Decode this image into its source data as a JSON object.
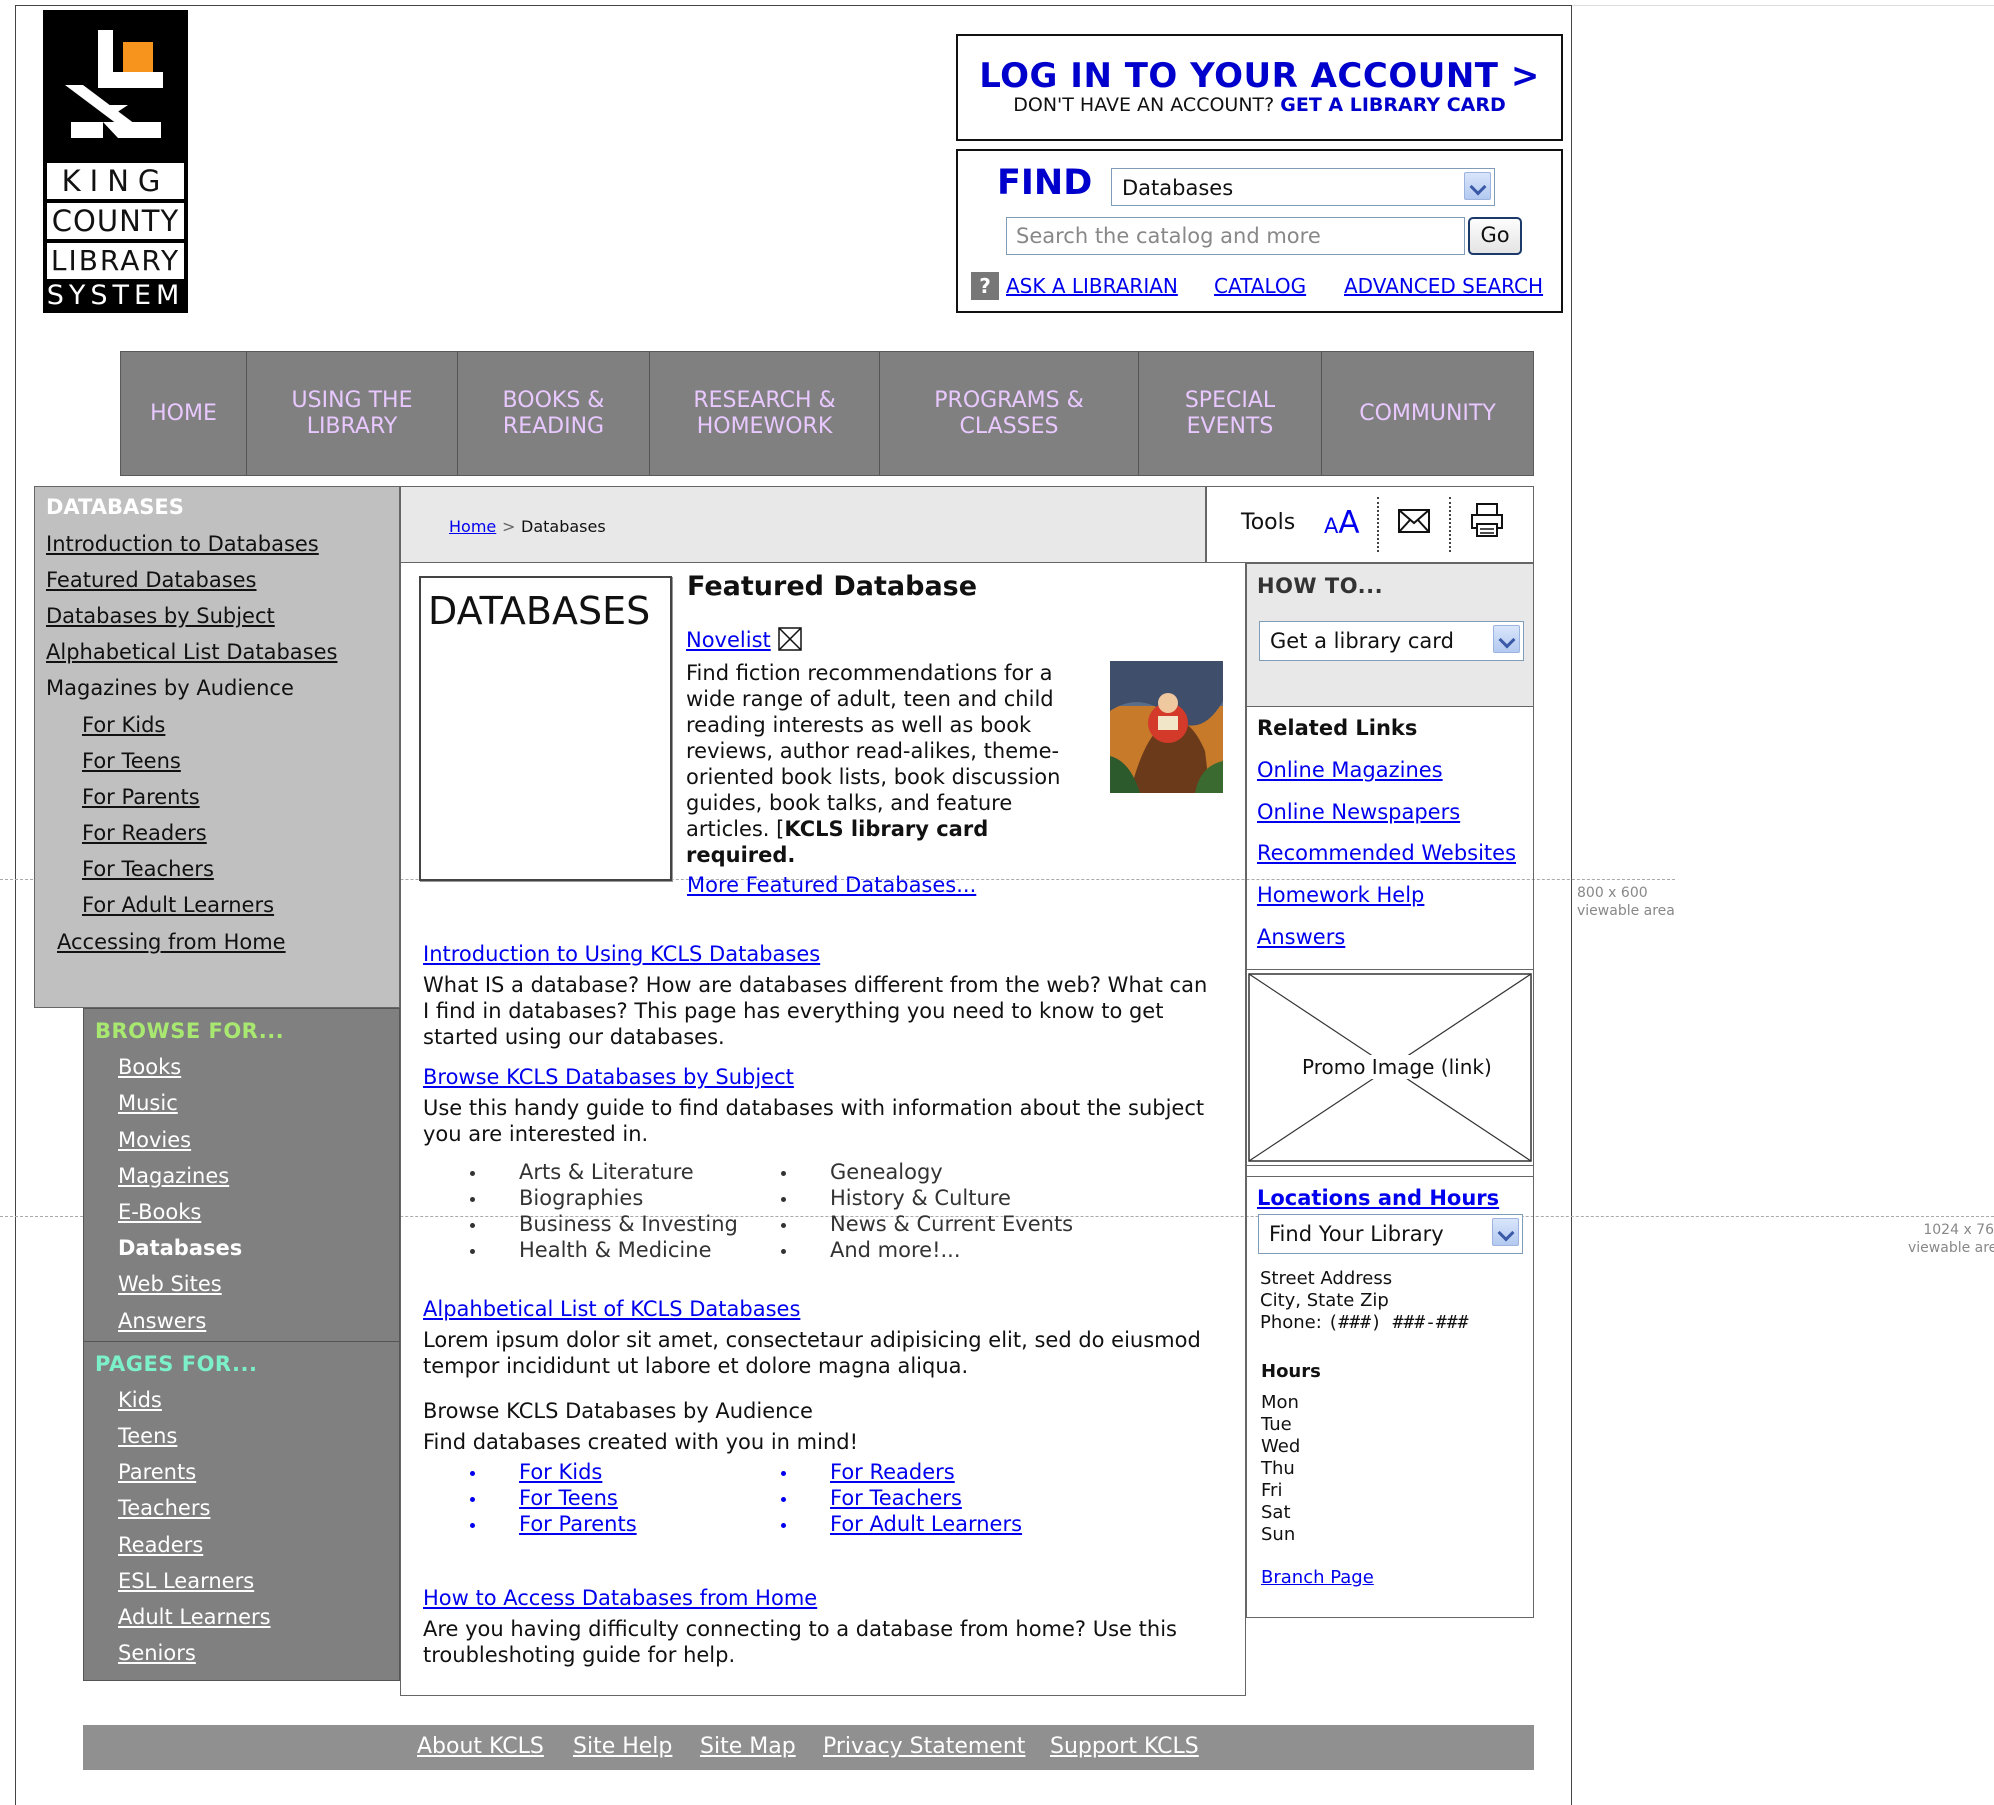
{
  "logo": {
    "line1": "KING",
    "line2": "COUNTY",
    "line3": "LIBRARY",
    "line4": "SYSTEM"
  },
  "viewport_notes": {
    "small": "800 x 600",
    "small_sub": "viewable area",
    "large": "1024 x 76",
    "large_sub": "viewable are"
  },
  "login": {
    "title": "LOG IN TO YOUR ACCOUNT >",
    "prompt": "DON'T HAVE AN ACCOUNT?",
    "card_link": "GET A LIBRARY CARD"
  },
  "find": {
    "label": "FIND",
    "scope_selected": "Databases",
    "search_placeholder": "Search the catalog and more",
    "go": "Go",
    "help_glyph": "?",
    "links": [
      "ASK A LIBRARIAN",
      "CATALOG",
      "ADVANCED SEARCH"
    ]
  },
  "nav": [
    {
      "l1": "HOME",
      "l2": ""
    },
    {
      "l1": "USING THE",
      "l2": "LIBRARY"
    },
    {
      "l1": "BOOKS &",
      "l2": "READING"
    },
    {
      "l1": "RESEARCH &",
      "l2": "HOMEWORK"
    },
    {
      "l1": "PROGRAMS &",
      "l2": "CLASSES"
    },
    {
      "l1": "SPECIAL",
      "l2": "EVENTS"
    },
    {
      "l1": "COMMUNITY",
      "l2": ""
    }
  ],
  "leftnav": {
    "heading": "DATABASES",
    "items": [
      "Introduction to Databases",
      "Featured Databases",
      "Databases by Subject",
      "Alphabetical List Databases",
      "Magazines by Audience",
      "For Kids",
      "For Teens",
      "For Parents",
      "For Readers",
      "For Teachers",
      "For Adult Learners",
      "Accessing from Home"
    ]
  },
  "browse": {
    "heading": "BROWSE FOR...",
    "items": [
      "Books",
      "Music",
      "Movies",
      "Magazines",
      "E-Books",
      "Databases",
      "Web Sites",
      "Answers"
    ],
    "pages_heading": "PAGES FOR...",
    "pages": [
      "Kids",
      "Teens",
      "Parents",
      "Teachers",
      "Readers",
      "ESL Learners",
      "Adult Learners",
      "Seniors"
    ]
  },
  "breadcrumb": {
    "home": "Home",
    "sep": ">",
    "current": "Databases"
  },
  "tools": {
    "label": "Tools",
    "font_small": "A",
    "font_large": "A"
  },
  "featured": {
    "box_title": "DATABASES",
    "heading": "Featured Database",
    "db_name": "Novelist",
    "desc_lines": [
      "Find fiction recommendations for a",
      "wide range of adult, teen and child",
      "reading interests as well as book",
      "reviews, author read-alikes, theme-",
      "oriented book lists, book discussion",
      "guides, book talks, and feature"
    ],
    "desc_last": "articles. [",
    "req_1": "KCLS library card",
    "req_2": "required.",
    "more": "More Featured Databases..."
  },
  "sections": {
    "intro_link": "Introduction to Using KCLS Databases",
    "intro_l1": "What IS a database? How are databases different from the web?  What can",
    "intro_l2": "I find in databases?  This page has everything you need to know to get",
    "intro_l3": "started using our databases.",
    "subject_link": "Browse KCLS Databases by Subject",
    "subject_l1": "Use this handy guide to find databases with information about the subject",
    "subject_l2": "you are interested in.",
    "subjects_a": [
      "Arts & Literature",
      "Biographies",
      "Business & Investing",
      "Health & Medicine"
    ],
    "subjects_b": [
      "Genealogy",
      "History & Culture",
      "News & Current Events",
      "And more!..."
    ],
    "alpha_link": "Alpahbetical List of KCLS Databases",
    "alpha_l1": "Lorem ipsum dolor sit amet, consectetaur adipisicing elit, sed do eiusmod",
    "alpha_l2": "tempor incididunt ut labore et dolore magna aliqua.",
    "aud_title": "Browse KCLS Databases by Audience",
    "aud_sub": "Find databases created with you in mind!",
    "aud_a": [
      "For Kids",
      "For Teens",
      "For Parents"
    ],
    "aud_b": [
      "For Readers",
      "For Teachers",
      "For Adult Learners"
    ],
    "home_link": "How to Access Databases from Home",
    "home_l1": "Are you having difficulty connecting to a database from home? Use this",
    "home_l2": "troubleshoting guide for help."
  },
  "howto": {
    "heading": "HOW TO...",
    "selected": "Get a library card"
  },
  "related": {
    "heading": "Related Links",
    "links": [
      "Online Magazines",
      "Online Newspapers",
      "Recommended Websites",
      "Homework Help",
      "Answers"
    ]
  },
  "promo": {
    "label": "Promo Image (link)"
  },
  "locations": {
    "heading": "Locations and Hours",
    "selected": "Find Your Library",
    "address": [
      "Street Address",
      "City, State Zip"
    ],
    "phone_label": "Phone:",
    "phone": "(###) ###-###",
    "hours_heading": "Hours",
    "days": [
      "Mon",
      "Tue",
      "Wed",
      "Thu",
      "Fri",
      "Sat",
      "Sun"
    ],
    "branch": "Branch Page"
  },
  "footer": [
    "About KCLS",
    "Site Help",
    "Site Map",
    "Privacy Statement",
    "Support KCLS"
  ],
  "colors": {
    "nav_bg": "#808080",
    "nav_text": "#e8c8ff",
    "link": "#0000ee",
    "accent_blue": "#0000cc",
    "browse_head": "#a8e870",
    "pages_head": "#7cf0c8",
    "logo_orange": "#f7941d"
  }
}
